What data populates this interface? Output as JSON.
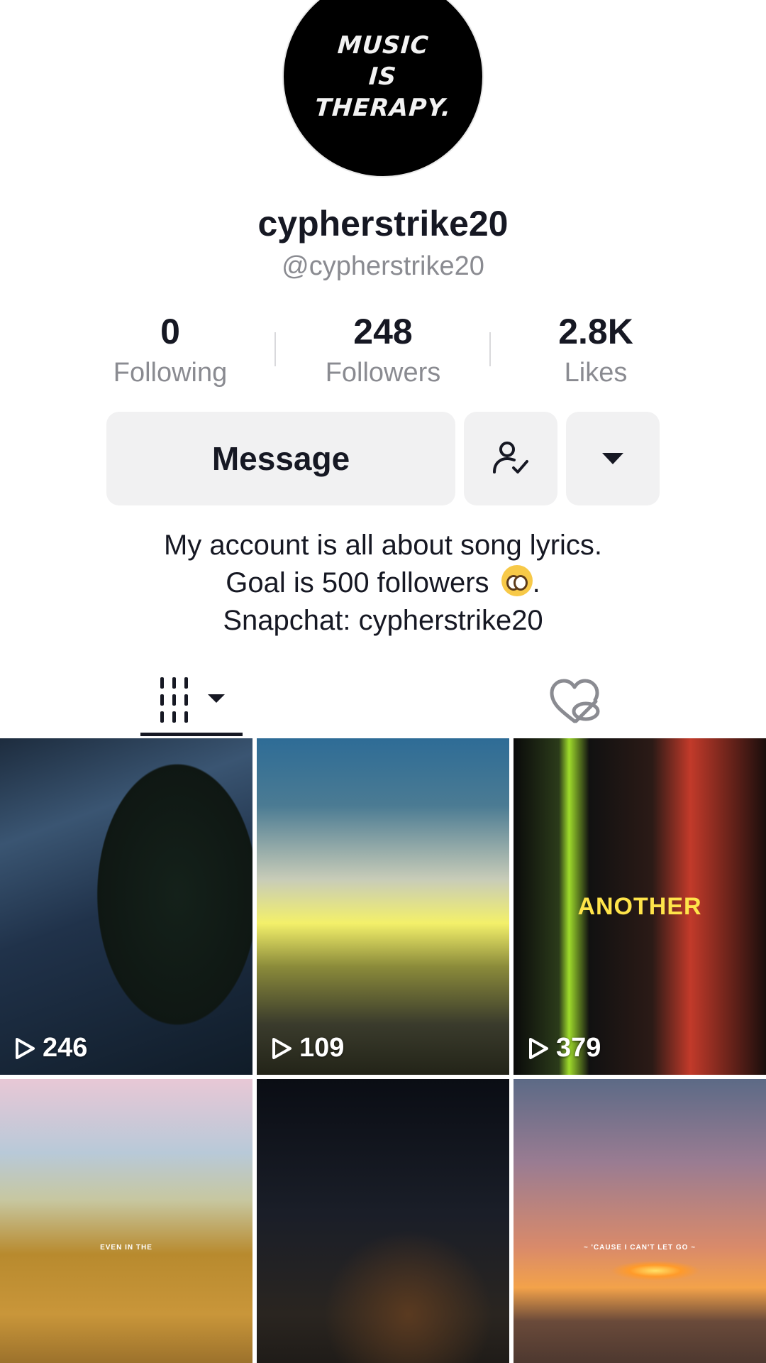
{
  "profile": {
    "avatar_text": [
      "MUSIC",
      "IS",
      "THERAPY."
    ],
    "display_name": "cypherstrike20",
    "handle": "@cypherstrike20"
  },
  "stats": {
    "following": {
      "value": "0",
      "label": "Following"
    },
    "followers": {
      "value": "248",
      "label": "Followers"
    },
    "likes": {
      "value": "2.8K",
      "label": "Likes"
    }
  },
  "actions": {
    "message_label": "Message",
    "friend_icon": "person-check-icon",
    "more_icon": "caret-down-icon"
  },
  "bio": {
    "line1": "My account is all about song lyrics.",
    "line2": "Goal is 500 followers",
    "line2_suffix": ".",
    "line2_emoji": "pleading-face-emoji",
    "line3": "Snapchat: cypherstrike20"
  },
  "tabs": {
    "videos_icon": "videos-grid-icon",
    "liked_icon": "liked-hidden-icon"
  },
  "videos": [
    {
      "views": "246"
    },
    {
      "views": "109",
      "overlay": ""
    },
    {
      "views": "379",
      "overlay": "ANOTHER"
    },
    {
      "views": "",
      "overlay": "EVEN IN THE"
    },
    {
      "views": "",
      "overlay": ""
    },
    {
      "views": "",
      "overlay": "~ 'CAUSE I CAN'T LET GO ~"
    }
  ],
  "colors": {
    "text_primary": "#161823",
    "text_secondary": "#8a8b91",
    "button_bg": "#f1f1f2"
  }
}
